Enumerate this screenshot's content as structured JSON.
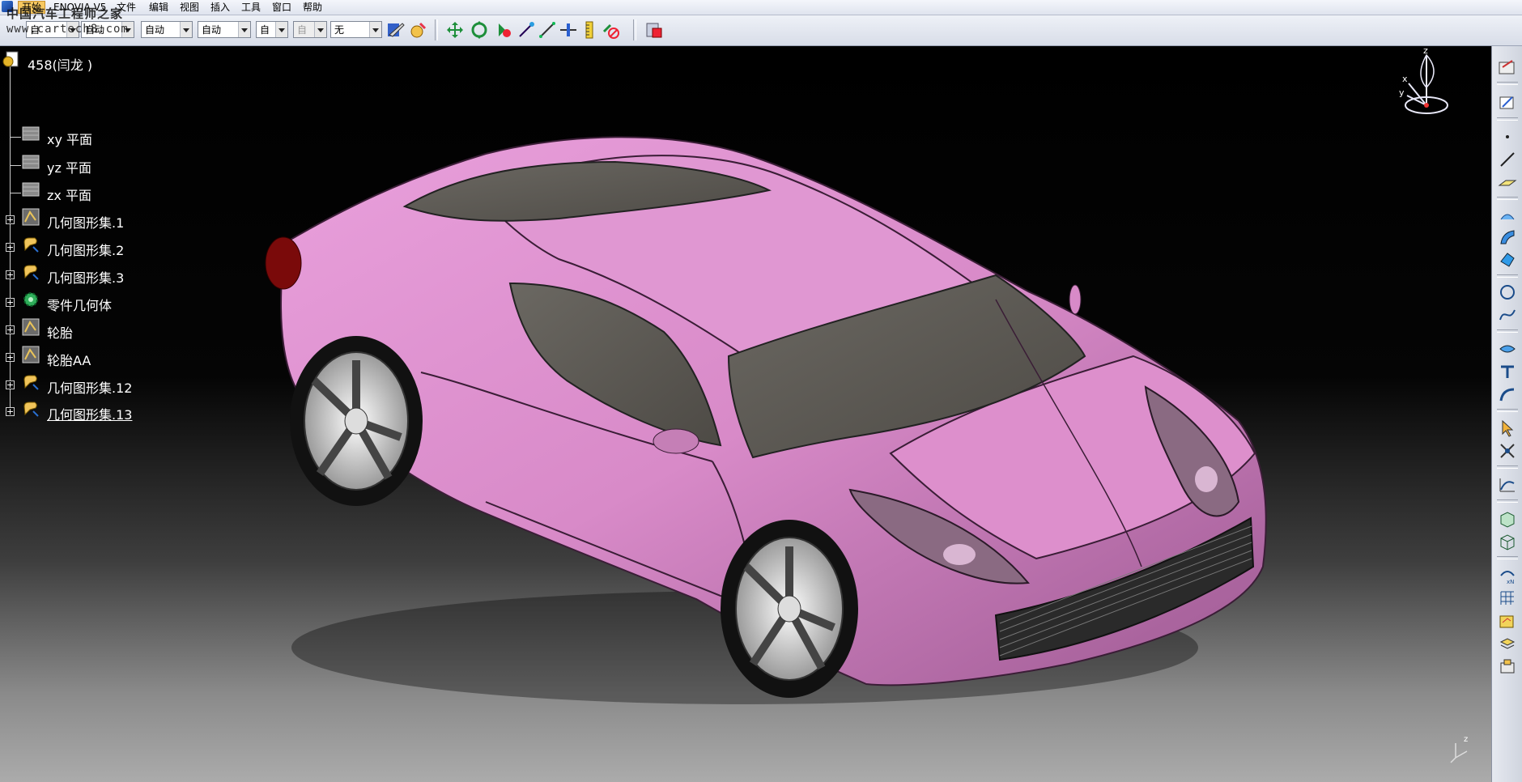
{
  "watermark": {
    "site_cn": "中国汽车工程师之家",
    "site_url": "www.cartech8.com"
  },
  "menubar": {
    "items": [
      "开始",
      "ENOVIA V5",
      "文件",
      "编辑",
      "视图",
      "插入",
      "工具",
      "窗口",
      "帮助"
    ],
    "active_index": 0
  },
  "toolbar": {
    "combos": [
      {
        "value": "自",
        "disabled": false
      },
      {
        "value": "自动",
        "disabled": false
      },
      {
        "value": "自动",
        "disabled": false
      },
      {
        "value": "自动",
        "disabled": false
      },
      {
        "value": "自动",
        "disabled": false
      },
      {
        "value": "自",
        "disabled": false
      },
      {
        "value": "自",
        "disabled": true
      },
      {
        "value": "无",
        "disabled": false
      }
    ],
    "icons": [
      "paint-brush-icon",
      "properties-icon",
      "pan-icon",
      "rotate-icon",
      "hide-show-icon",
      "wand-icon",
      "line-icon",
      "measure-icon",
      "ruler-icon",
      "no-snap-icon",
      "catalog-icon"
    ]
  },
  "tree": {
    "root": "458(闫龙 )",
    "children": [
      {
        "label": "xy 平面",
        "icon": "plane-icon",
        "expandable": false
      },
      {
        "label": "yz 平面",
        "icon": "plane-icon",
        "expandable": false
      },
      {
        "label": "zx 平面",
        "icon": "plane-icon",
        "expandable": false
      },
      {
        "label": "几何图形集.1",
        "icon": "geometrical-set-icon",
        "expandable": true
      },
      {
        "label": "几何图形集.2",
        "icon": "geometrical-set-hand-icon",
        "expandable": true
      },
      {
        "label": "几何图形集.3",
        "icon": "geometrical-set-hand-icon",
        "expandable": true
      },
      {
        "label": "零件几何体",
        "icon": "part-body-gear-icon",
        "expandable": true
      },
      {
        "label": "轮胎",
        "icon": "geometrical-set-icon",
        "expandable": true
      },
      {
        "label": "轮胎AA",
        "icon": "geometrical-set-icon",
        "expandable": true
      },
      {
        "label": "几何图形集.12",
        "icon": "geometrical-set-hand-icon",
        "expandable": true
      },
      {
        "label": "几何图形集.13",
        "icon": "geometrical-set-hand-icon",
        "expandable": true,
        "selected": true
      }
    ]
  },
  "compass": {
    "axes": [
      "z",
      "x",
      "y"
    ]
  },
  "mini_axis": {
    "label": "z"
  },
  "right_toolbar": {
    "icons": [
      "sketch-view-icon",
      "sketcher-icon",
      "point-icon",
      "line-icon",
      "plane-icon",
      "extrude-surface-icon",
      "sweep-icon",
      "fill-icon",
      "circle-icon",
      "spline-icon",
      "join-icon",
      "trim-icon",
      "boundary-icon",
      "select-icon",
      "repetition-icon",
      "law-icon",
      "box-icon",
      "wireframe-box-icon",
      "transform-icon",
      "grid-icon",
      "analysis-icon",
      "layers-icon",
      "catalog-icon"
    ]
  },
  "colors": {
    "car_body": "#d88ac8",
    "glass": "#5a5752",
    "viewport_top": "#000000",
    "viewport_bottom": "#ababab"
  }
}
